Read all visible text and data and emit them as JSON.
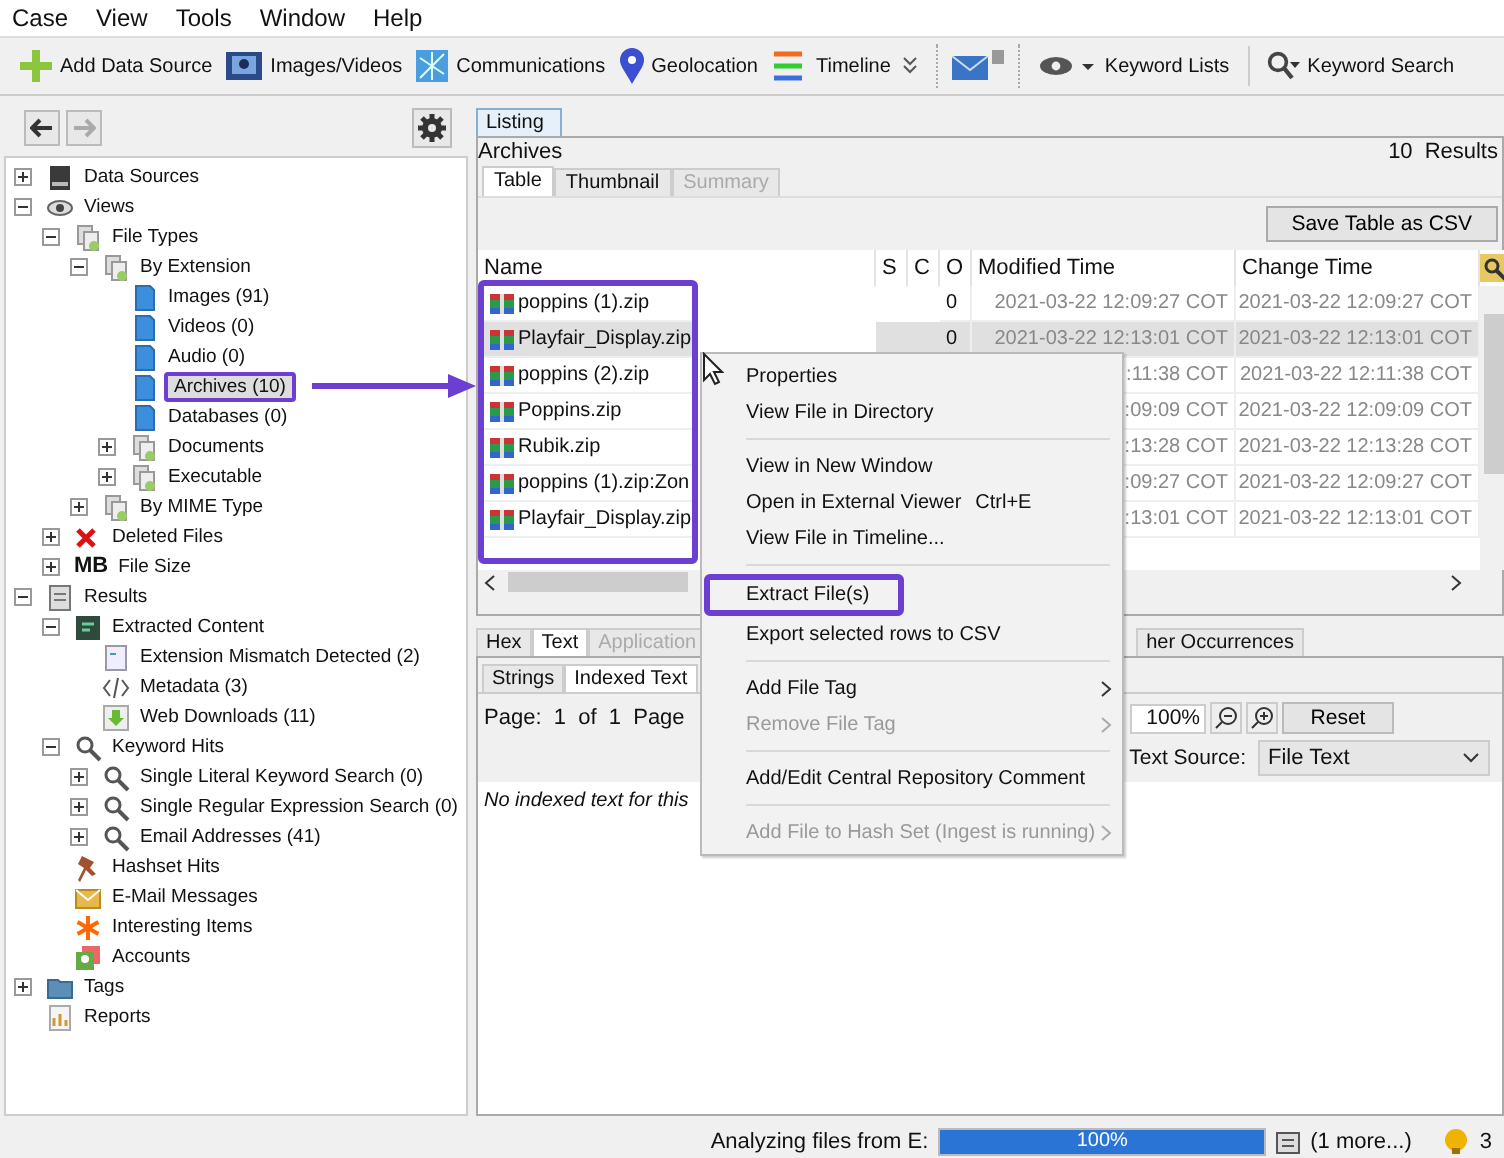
{
  "menu_bar": [
    "Case",
    "View",
    "Tools",
    "Window",
    "Help"
  ],
  "toolbar": [
    {
      "kind": "add",
      "label": "Add Data Source"
    },
    {
      "kind": "images",
      "label": "Images/Videos"
    },
    {
      "kind": "communications",
      "label": "Communications"
    },
    {
      "kind": "geolocation",
      "label": "Geolocation"
    },
    {
      "kind": "timeline",
      "label": "Timeline"
    },
    {
      "kind": "overflow"
    },
    {
      "kind": "mail"
    },
    {
      "kind": "keyword_lists",
      "label": "Keyword Lists"
    },
    {
      "kind": "keyword_search",
      "label": "Keyword Search"
    }
  ],
  "tree": [
    {
      "kind": "disk",
      "label": "Data Sources",
      "expanded": false,
      "selected": false
    },
    {
      "kind": "eye",
      "label": "Views",
      "expanded": true,
      "selected": false,
      "children": [
        {
          "kind": "filetype",
          "label": "File Types",
          "expanded": true,
          "selected": false,
          "children": [
            {
              "kind": "filetype",
              "label": "By Extension",
              "expanded": true,
              "selected": false,
              "children": [
                {
                  "kind": "document",
                  "label": "Images (91)",
                  "selected": false
                },
                {
                  "kind": "document",
                  "label": "Videos (0)",
                  "selected": false
                },
                {
                  "kind": "document",
                  "label": "Audio (0)",
                  "selected": false
                },
                {
                  "kind": "document",
                  "label": "Archives (10)",
                  "selected": true
                },
                {
                  "kind": "document",
                  "label": "Databases (0)",
                  "selected": false
                },
                {
                  "kind": "filetype",
                  "label": "Documents",
                  "expanded": false,
                  "selected": false
                },
                {
                  "kind": "filetype",
                  "label": "Executable",
                  "expanded": false,
                  "selected": false
                }
              ]
            },
            {
              "kind": "filetype",
              "label": "By MIME Type",
              "expanded": false,
              "selected": false
            }
          ]
        },
        {
          "kind": "deleted",
          "label": "Deleted Files",
          "expanded": false,
          "selected": false
        },
        {
          "kind": "size",
          "badge": "MB",
          "label": "File Size",
          "expanded": false,
          "selected": false
        }
      ]
    },
    {
      "kind": "results",
      "label": "Results",
      "expanded": true,
      "selected": false,
      "children": [
        {
          "kind": "extracted",
          "label": "Extracted Content",
          "expanded": true,
          "selected": false,
          "children": [
            {
              "kind": "mismatch",
              "label": "Extension Mismatch Detected (2)",
              "selected": false
            },
            {
              "kind": "metadata",
              "label": "Metadata (3)",
              "selected": false
            },
            {
              "kind": "download",
              "label": "Web Downloads (11)",
              "selected": false
            }
          ]
        },
        {
          "kind": "search",
          "label": "Keyword Hits",
          "expanded": true,
          "selected": false,
          "children": [
            {
              "kind": "search",
              "label": "Single Literal Keyword Search (0)",
              "expanded": false,
              "selected": false
            },
            {
              "kind": "search",
              "label": "Single Regular Expression Search (0)",
              "expanded": false,
              "selected": false
            },
            {
              "kind": "search",
              "label": "Email Addresses (41)",
              "expanded": false,
              "selected": false
            }
          ]
        },
        {
          "kind": "hashset",
          "label": "Hashset Hits",
          "selected": false
        },
        {
          "kind": "email",
          "label": "E-Mail Messages",
          "selected": false
        },
        {
          "kind": "interesting",
          "label": "Interesting Items",
          "selected": false
        },
        {
          "kind": "accounts",
          "label": "Accounts",
          "selected": false
        }
      ]
    },
    {
      "kind": "tags",
      "label": "Tags",
      "expanded": false,
      "selected": false
    },
    {
      "kind": "reports",
      "label": "Reports",
      "selected": false
    }
  ],
  "listing": {
    "tab": "Listing",
    "title": "Archives",
    "count": "10",
    "count_label": "Results",
    "view_tabs": [
      {
        "label": "Table",
        "selected": true,
        "disabled": false
      },
      {
        "label": "Thumbnail",
        "selected": false,
        "disabled": false
      },
      {
        "label": "Summary",
        "selected": false,
        "disabled": true
      }
    ],
    "save_button": "Save Table as CSV",
    "columns": [
      "Name",
      "S",
      "C",
      "O",
      "Modified Time",
      "Change Time"
    ],
    "rows": [
      {
        "name": "poppins (1).zip",
        "o": "0",
        "modified": "2021-03-22 12:09:27 COT",
        "changed": "2021-03-22 12:09:27 COT",
        "selected": false
      },
      {
        "name": "Playfair_Display.zip",
        "o": "0",
        "modified": "2021-03-22 12:13:01 COT",
        "changed": "2021-03-22 12:13:01 COT",
        "selected": true
      },
      {
        "name": "poppins (2).zip",
        "modified": ":11:38 COT",
        "changed": "2021-03-22 12:11:38 COT",
        "selected": false
      },
      {
        "name": "Poppins.zip",
        "modified": ":09:09 COT",
        "changed": "2021-03-22 12:09:09 COT",
        "selected": false
      },
      {
        "name": "Rubik.zip",
        "modified": ":13:28 COT",
        "changed": "2021-03-22 12:13:28 COT",
        "selected": false
      },
      {
        "name": "poppins (1).zip:Zon",
        "modified": ":09:27 COT",
        "changed": "2021-03-22 12:09:27 COT",
        "selected": false
      },
      {
        "name": "Playfair_Display.zip",
        "modified": ":13:01 COT",
        "changed": "2021-03-22 12:13:01 COT",
        "selected": false
      }
    ]
  },
  "viewer": {
    "tabs": [
      {
        "label": "Hex",
        "selected": false,
        "disabled": false
      },
      {
        "label": "Text",
        "selected": true,
        "disabled": false
      },
      {
        "label": "Application",
        "selected": false,
        "disabled": true
      },
      {
        "label": "her Occurrences",
        "selected": false,
        "disabled": false
      }
    ],
    "sub_tabs": [
      {
        "label": "Strings",
        "selected": false
      },
      {
        "label": "Indexed Text",
        "selected": true
      }
    ],
    "page_info": "Page:  1  of  1  Page",
    "zoom": "100%",
    "reset": "Reset",
    "text_source_label": "Text Source:",
    "text_source": "File Text",
    "message": "No indexed text for this"
  },
  "context_menu": [
    {
      "kind": "item",
      "label": "Properties",
      "disabled": false,
      "highlighted": false
    },
    {
      "kind": "item",
      "label": "View File in Directory",
      "disabled": false,
      "highlighted": false
    },
    {
      "kind": "separator"
    },
    {
      "kind": "item",
      "label": "View in New Window",
      "disabled": false,
      "highlighted": false
    },
    {
      "kind": "item",
      "label": "Open in External Viewer",
      "shortcut": "Ctrl+E",
      "disabled": false,
      "highlighted": false
    },
    {
      "kind": "item",
      "label": "View File in Timeline...",
      "disabled": false,
      "highlighted": false
    },
    {
      "kind": "separator"
    },
    {
      "kind": "item",
      "label": "Extract File(s)",
      "disabled": false,
      "highlighted": true
    },
    {
      "kind": "item",
      "label": "Export selected rows to CSV",
      "disabled": false,
      "highlighted": false
    },
    {
      "kind": "separator"
    },
    {
      "kind": "item",
      "label": "Add File Tag",
      "submenu": true,
      "disabled": false,
      "highlighted": false
    },
    {
      "kind": "item",
      "label": "Remove File Tag",
      "submenu": true,
      "disabled": true,
      "highlighted": false
    },
    {
      "kind": "separator"
    },
    {
      "kind": "item",
      "label": "Add/Edit Central Repository Comment",
      "disabled": false,
      "highlighted": false
    },
    {
      "kind": "separator"
    },
    {
      "kind": "item",
      "label": "Add File to Hash Set (Ingest is running)",
      "submenu": true,
      "disabled": true,
      "highlighted": false
    }
  ],
  "status_bar": {
    "text": "Analyzing files from E:",
    "progress": {
      "level": 1,
      "label": "100%"
    },
    "more": "(1 more...)",
    "notifications": "3"
  }
}
